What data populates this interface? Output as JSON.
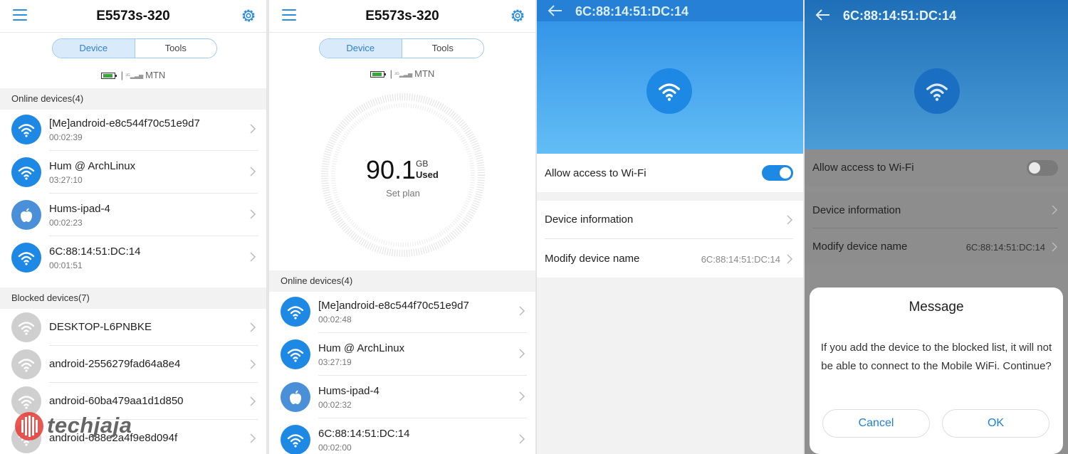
{
  "screens": {
    "device_list": {
      "title": "E5573s-320",
      "tabs": [
        "Device",
        "Tools"
      ],
      "network": "MTN",
      "online_header": "Online devices(4)",
      "online": [
        {
          "name": "[Me]android-e8c544f70c51e9d7",
          "time": "00:02:39",
          "icon": "wifi-icon"
        },
        {
          "name": "Hum @ ArchLinux",
          "time": "03:27:10",
          "icon": "wifi-icon"
        },
        {
          "name": "Hums-ipad-4",
          "time": "00:02:23",
          "icon": "apple-icon"
        },
        {
          "name": "6C:88:14:51:DC:14",
          "time": "00:01:51",
          "icon": "wifi-icon"
        }
      ],
      "blocked_header": "Blocked devices(7)",
      "blocked": [
        {
          "name": "DESKTOP-L6PNBKE"
        },
        {
          "name": "android-2556279fad64a8e4"
        },
        {
          "name": "android-60ba479aa1d1d850"
        },
        {
          "name": "android-688e2a4f9e8d094f"
        }
      ]
    },
    "usage": {
      "title": "E5573s-320",
      "tabs": [
        "Device",
        "Tools"
      ],
      "network": "MTN",
      "usage_value": "90.1",
      "usage_unit": "GB",
      "usage_label": "Used",
      "plan_link": "Set plan",
      "online_header": "Online devices(4)",
      "online": [
        {
          "name": "[Me]android-e8c544f70c51e9d7",
          "time": "00:02:48",
          "icon": "wifi-icon"
        },
        {
          "name": "Hum @ ArchLinux",
          "time": "03:27:19",
          "icon": "wifi-icon"
        },
        {
          "name": "Hums-ipad-4",
          "time": "00:02:32",
          "icon": "apple-icon"
        },
        {
          "name": "6C:88:14:51:DC:14",
          "time": "00:02:00",
          "icon": "wifi-icon"
        }
      ]
    },
    "details_allowed": {
      "title": "6C:88:14:51:DC:14",
      "allow_label": "Allow access to Wi-Fi",
      "allow_on": true,
      "info_label": "Device information",
      "modify_label": "Modify device name",
      "device_name": "6C:88:14:51:DC:14"
    },
    "details_blocked": {
      "title": "6C:88:14:51:DC:14",
      "allow_label": "Allow access to Wi-Fi",
      "allow_on": false,
      "info_label": "Device information",
      "modify_label": "Modify device name",
      "device_name": "6C:88:14:51:DC:14",
      "dialog": {
        "title": "Message",
        "message": "If you add the device to the blocked list, it will not be able to connect to the Mobile WiFi. Continue?",
        "cancel": "Cancel",
        "ok": "OK"
      }
    }
  },
  "watermark": "techjaja",
  "colors": {
    "accent": "#1e88e5",
    "header_blue": "#2d8fe6",
    "blocked_gray": "#cfcfcf"
  }
}
